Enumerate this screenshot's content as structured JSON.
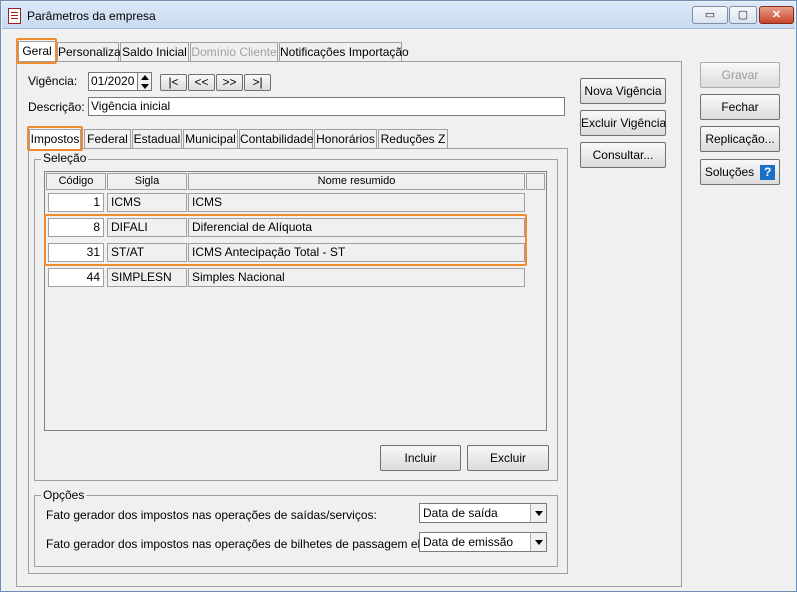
{
  "window": {
    "title": "Parâmetros da empresa",
    "min": "▭",
    "max": "▢",
    "close": "✕"
  },
  "top_tabs": [
    "Geral",
    "Personaliza",
    "Saldo Inicial",
    "Domínio Cliente",
    "Notificações Importação"
  ],
  "vigencia": {
    "label": "Vigência:",
    "value": "01/2020",
    "nav": [
      "|<",
      "<<",
      ">>",
      ">|"
    ]
  },
  "descricao": {
    "label": "Descrição:",
    "value": "Vigência inicial"
  },
  "mid_buttons": [
    "Nova Vigência",
    "Excluir Vigência",
    "Consultar..."
  ],
  "right_buttons": [
    "Gravar",
    "Fechar",
    "Replicação...",
    "Soluções"
  ],
  "help_icon": "?",
  "sub_tabs": [
    "Impostos",
    "Federal",
    "Estadual",
    "Municipal",
    "Contabilidade",
    "Honorários",
    "Reduções Z"
  ],
  "selecao": {
    "title": "Seleção",
    "columns": [
      "Código",
      "Sigla",
      "Nome resumido"
    ],
    "rows": [
      {
        "codigo": "1",
        "sigla": "ICMS",
        "nome": "ICMS"
      },
      {
        "codigo": "8",
        "sigla": "DIFALI",
        "nome": "Diferencial de Alíquota"
      },
      {
        "codigo": "31",
        "sigla": "ST/AT",
        "nome": "ICMS Antecipação Total - ST"
      },
      {
        "codigo": "44",
        "sigla": "SIMPLESN",
        "nome": "Simples Nacional"
      }
    ],
    "incluir": "Incluir",
    "excluir": "Excluir"
  },
  "opcoes": {
    "title": "Opções",
    "op1_label": "Fato gerador dos impostos nas operações de saídas/serviços:",
    "op1_value": "Data de saída",
    "op2_label": "Fato gerador dos impostos nas operações de bilhetes de passagem eletrônico:",
    "op2_value": "Data de emissão"
  },
  "colors": {
    "highlight": "#f08c2a",
    "help": "#1a6fc9"
  }
}
